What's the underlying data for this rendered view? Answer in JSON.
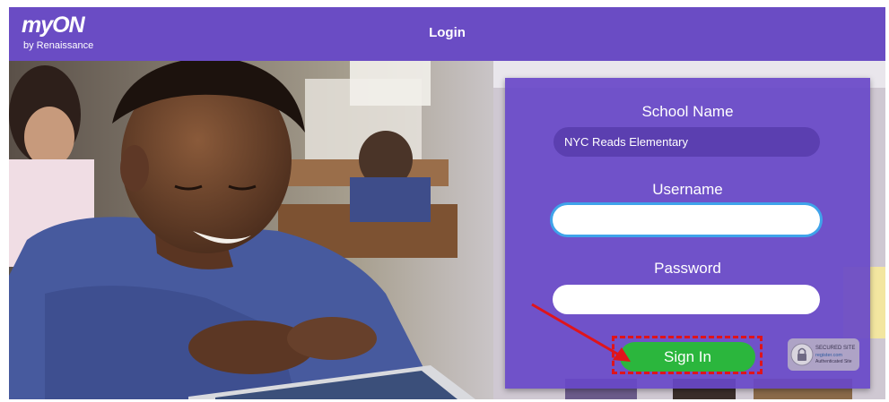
{
  "header": {
    "logo_text": "myON",
    "logo_sub": "by Renaissance",
    "title": "Login"
  },
  "login": {
    "school_label": "School Name",
    "school_value": "NYC Reads Elementary",
    "username_label": "Username",
    "username_value": "",
    "password_label": "Password",
    "password_value": "",
    "signin_label": "Sign In",
    "secured_badge": [
      "SECURED SITE",
      "register.com",
      "Authenticated Site"
    ]
  },
  "colors": {
    "brand_purple": "#6a4cc4",
    "panel_purple": "#6848c8",
    "signin_green": "#2bb63d",
    "focus_blue": "#3fa3ea",
    "annotation_red": "#e0141b"
  },
  "icons": [
    "lock-icon",
    "arrow-annotation-icon"
  ]
}
